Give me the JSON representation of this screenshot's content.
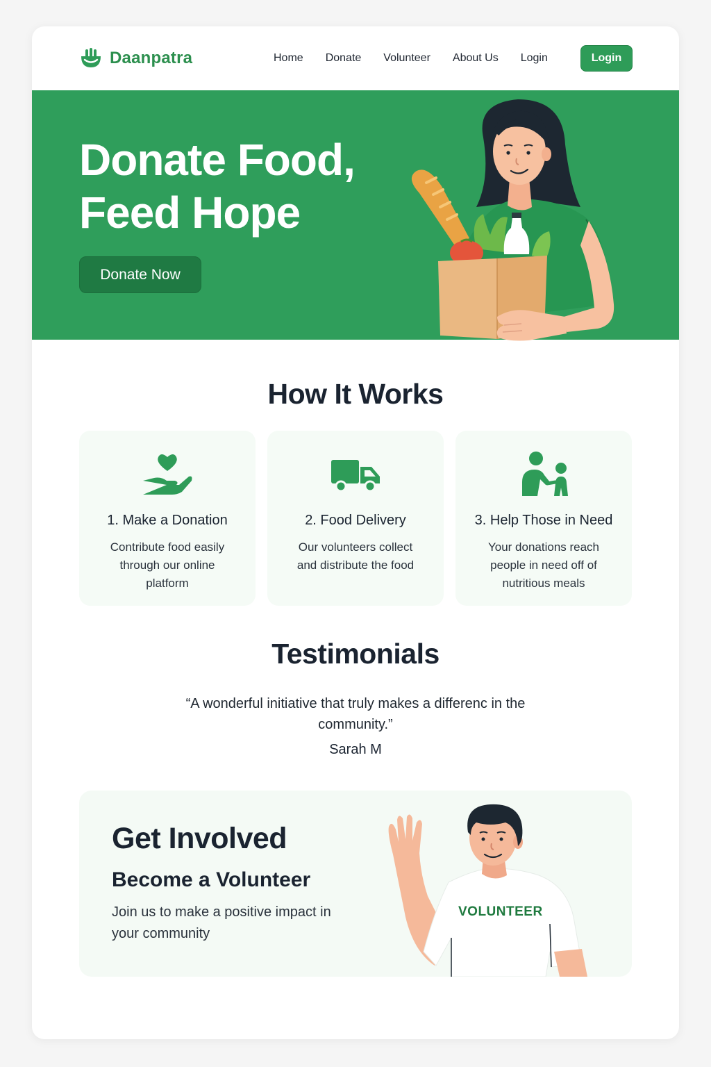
{
  "brand": {
    "name": "Daanpatra",
    "accent": "#2e9c58",
    "dark_accent": "#1f7a43",
    "logo_icon": "hand-bowl-icon"
  },
  "nav": {
    "links": [
      "Home",
      "Donate",
      "Volunteer",
      "About Us",
      "Login"
    ],
    "login_button": "Login"
  },
  "hero": {
    "title_line1": "Donate Food,",
    "title_line2": "Feed Hope",
    "cta": "Donate Now",
    "illustration": "woman-holding-grocery-bag"
  },
  "how_it_works": {
    "title": "How It Works",
    "steps": [
      {
        "icon": "heart-hand-icon",
        "title": "1. Make a Donation",
        "desc": "Contribute food easily through our online platform"
      },
      {
        "icon": "truck-icon",
        "title": "2. Food Delivery",
        "desc": "Our volunteers collect and distribute the food"
      },
      {
        "icon": "people-helping-icon",
        "title": "3. Help Those in Need",
        "desc": "Your donations reach people in need off of nutritious meals"
      }
    ]
  },
  "testimonials": {
    "title": "Testimonials",
    "quote": "“A wonderful initiative that truly makes a differenc in the community.”",
    "author": "Sarah M"
  },
  "get_involved": {
    "title": "Get Involved",
    "subtitle": "Become a Volunteer",
    "desc": "Join us to make a positive impact in your community",
    "shirt_text": "VOLUNTEER",
    "illustration": "waving-volunteer"
  }
}
